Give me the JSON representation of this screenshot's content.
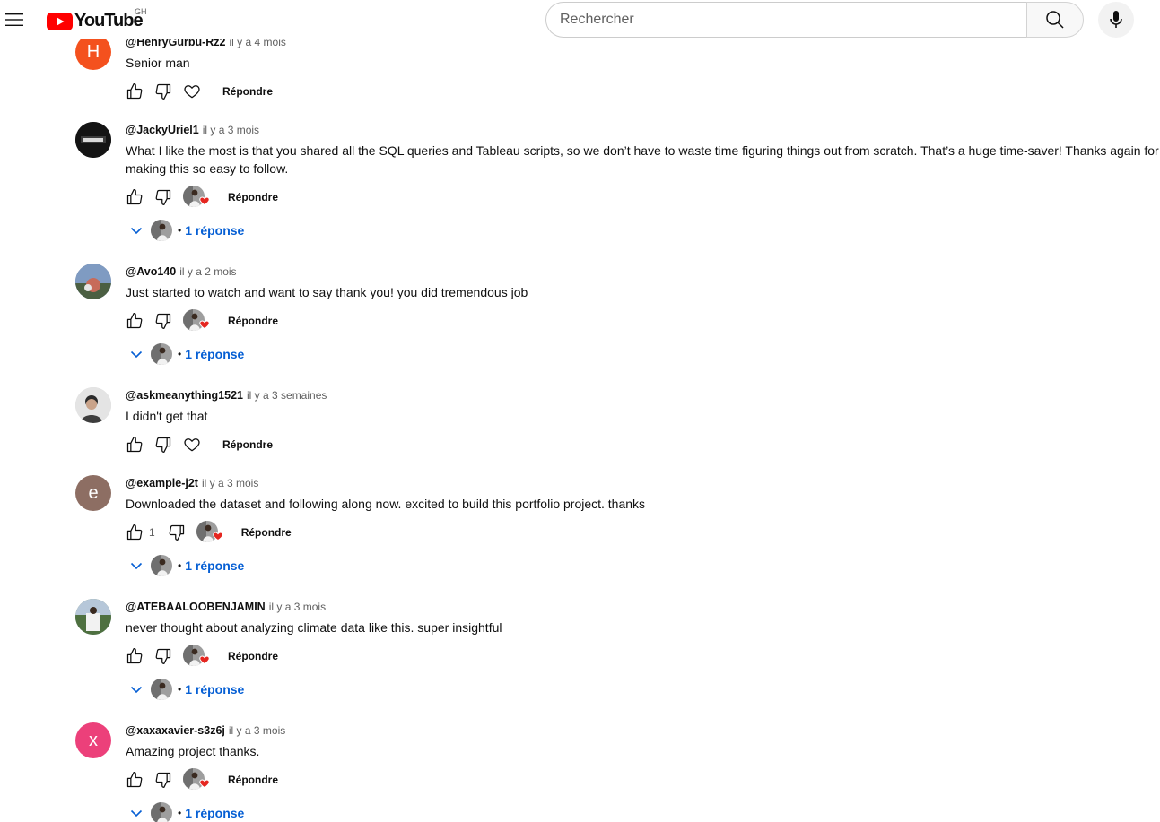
{
  "header": {
    "logo_text": "YouTube",
    "country_code": "GH",
    "search_placeholder": "Rechercher"
  },
  "comments": [
    {
      "author": "@HenryGurbu-Rz2",
      "time": "il y a 4 mois",
      "text": "Senior man",
      "avatar_letter": "H",
      "avatar_color": "#f4511e",
      "likes": "",
      "creator_heart": false,
      "reply_label": "Répondre",
      "replies_label": ""
    },
    {
      "author": "@JackyUriel1",
      "time": "il y a 3 mois",
      "text": "What I like the most is that you shared all the SQL queries and Tableau scripts, so we don’t have to waste time figuring things out from scratch. That’s a huge time-saver! Thanks again for making this so easy to follow.",
      "avatar_letter": "",
      "avatar_color": "#1b1b1b",
      "likes": "",
      "creator_heart": true,
      "reply_label": "Répondre",
      "replies_label": "1 réponse"
    },
    {
      "author": "@Avo140",
      "time": "il y a 2 mois",
      "text": "Just started to watch and want to say thank you! you did tremendous job",
      "avatar_letter": "",
      "avatar_color": "#5b6f8c",
      "likes": "",
      "creator_heart": true,
      "reply_label": "Répondre",
      "replies_label": "1 réponse"
    },
    {
      "author": "@askmeanything1521",
      "time": "il y a 3 semaines",
      "text": "I didn't get that",
      "avatar_letter": "",
      "avatar_color": "#cfcfcf",
      "likes": "",
      "creator_heart": false,
      "reply_label": "Répondre",
      "replies_label": ""
    },
    {
      "author": "@example-j2t",
      "time": "il y a 3 mois",
      "text": "Downloaded the dataset and following along now. excited to build this portfolio project. thanks",
      "avatar_letter": "e",
      "avatar_color": "#8d6e63",
      "likes": "1",
      "creator_heart": true,
      "reply_label": "Répondre",
      "replies_label": "1 réponse"
    },
    {
      "author": "@ATEBAALOOBENJAMIN",
      "time": "il y a 3 mois",
      "text": "never thought about analyzing climate data like this. super insightful",
      "avatar_letter": "",
      "avatar_color": "#5a7a4e",
      "likes": "",
      "creator_heart": true,
      "reply_label": "Répondre",
      "replies_label": "1 réponse"
    },
    {
      "author": "@xaxaxavier-s3z6j",
      "time": "il y a 3 mois",
      "text": "Amazing project thanks.",
      "avatar_letter": "x",
      "avatar_color": "#ec407a",
      "likes": "",
      "creator_heart": true,
      "reply_label": "Répondre",
      "replies_label": "1 réponse"
    }
  ],
  "colors": {
    "brand_red": "#ff0000",
    "link_blue": "#065fd4",
    "heart_red": "#e52620",
    "meta_gray": "#606060"
  },
  "icons": {
    "menu": "hamburger-icon",
    "search": "search-icon",
    "mic": "microphone-icon",
    "like": "thumbs-up-icon",
    "dislike": "thumbs-down-icon",
    "heart": "heart-outline-icon",
    "expand": "chevron-down-icon"
  }
}
